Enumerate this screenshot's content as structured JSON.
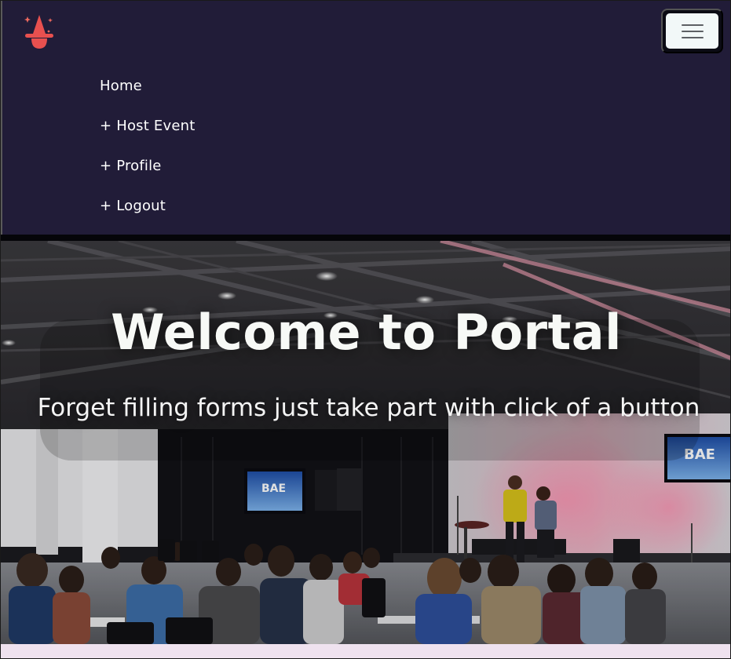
{
  "navbar": {
    "brand_icon": "wizard-hat-logo-icon",
    "toggler_icon": "hamburger-menu-icon",
    "background_color": "#211c38",
    "items": [
      {
        "label": "Home"
      },
      {
        "label": "+ Host Event"
      },
      {
        "label": "+ Profile"
      },
      {
        "label": "+ Logout"
      }
    ]
  },
  "hero": {
    "title": "Welcome to Portal",
    "subtitle": "Forget filling forms just take part with click of a button",
    "background_image": "event-hall-audience-photo",
    "screen_text": "BAE"
  },
  "colors": {
    "navbar_bg": "#211c38",
    "toggler_bg": "#f2f8f8",
    "brand_accent": "#e8504f",
    "text_light": "#ffffff"
  }
}
